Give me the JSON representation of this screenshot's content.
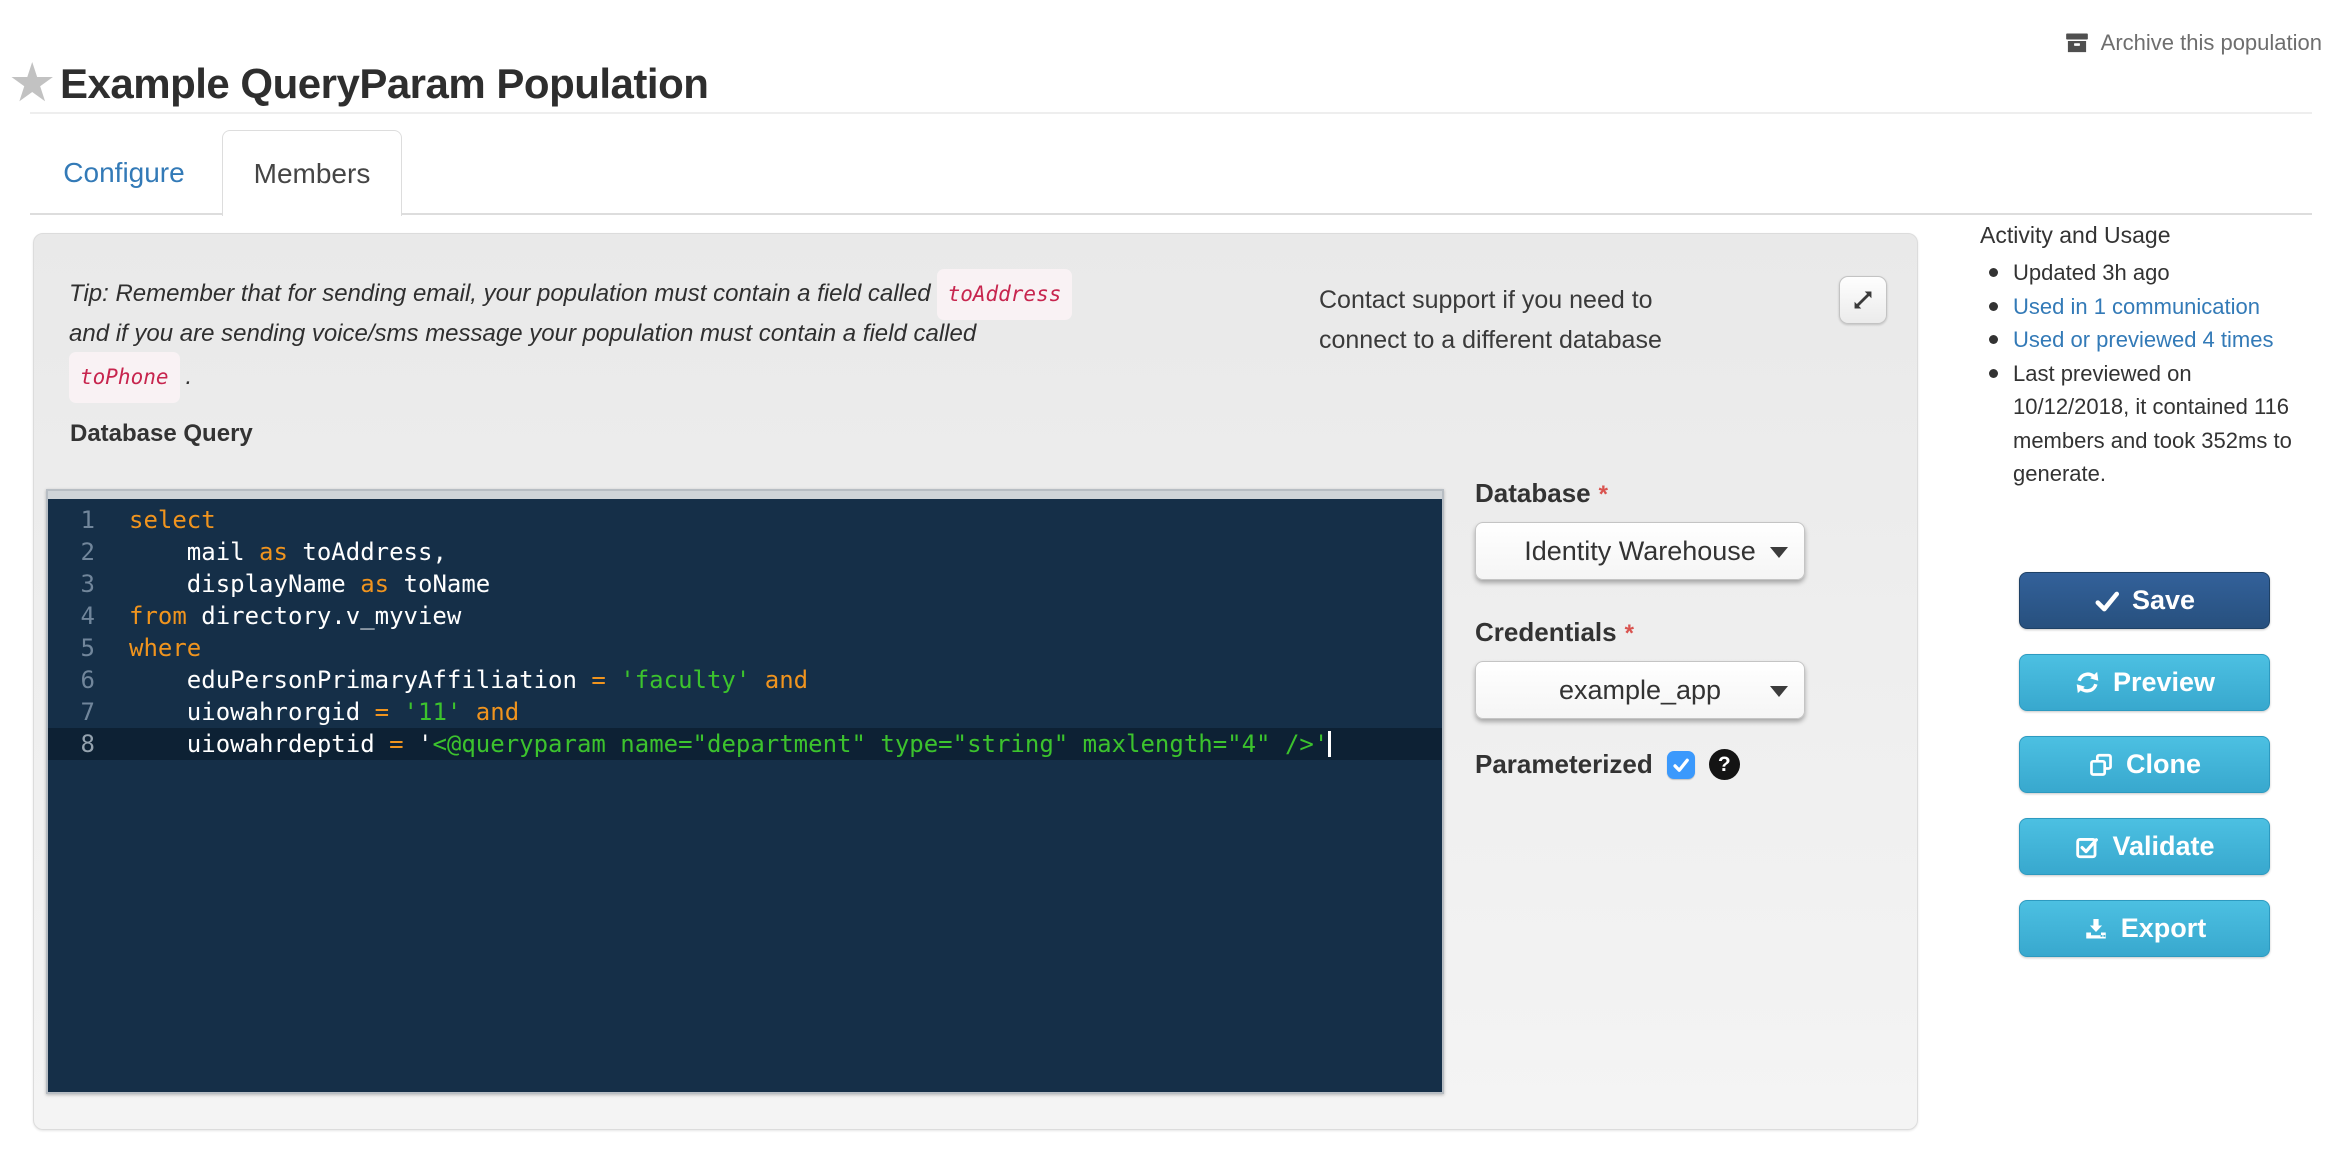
{
  "header": {
    "archive_label": "Archive this population",
    "title": "Example QueryParam Population"
  },
  "tabs": [
    {
      "label": "Configure",
      "active": false
    },
    {
      "label": "Members",
      "active": true
    }
  ],
  "panel": {
    "tip": {
      "line1_text": "Tip: Remember that for sending email, your population must contain a field called",
      "line1_code": "toAddress",
      "line2_text": "and if you are sending voice/sms message your population must contain a field called",
      "line3_code": "toPhone",
      "line3_suffix": "."
    },
    "contact_line1": "Contact support if you need to",
    "contact_line2": "connect to a different database",
    "query_label": "Database Query",
    "editor": {
      "lines": [
        {
          "num": "1",
          "tokens": [
            [
              "kw",
              "select"
            ]
          ]
        },
        {
          "num": "2",
          "tokens": [
            [
              "pl",
              "    mail "
            ],
            [
              "kw",
              "as"
            ],
            [
              "pl",
              " toAddress,"
            ]
          ]
        },
        {
          "num": "3",
          "tokens": [
            [
              "pl",
              "    displayName "
            ],
            [
              "kw",
              "as"
            ],
            [
              "pl",
              " toName"
            ]
          ]
        },
        {
          "num": "4",
          "tokens": [
            [
              "kw",
              "from"
            ],
            [
              "pl",
              " directory.v_myview"
            ]
          ]
        },
        {
          "num": "5",
          "tokens": [
            [
              "kw",
              "where"
            ]
          ]
        },
        {
          "num": "6",
          "tokens": [
            [
              "pl",
              "    eduPersonPrimaryAffiliation "
            ],
            [
              "kw",
              "="
            ],
            [
              "pl",
              " "
            ],
            [
              "str",
              "'faculty'"
            ],
            [
              "pl",
              " "
            ],
            [
              "kw",
              "and"
            ]
          ]
        },
        {
          "num": "7",
          "tokens": [
            [
              "pl",
              "    uiowahrorgid "
            ],
            [
              "kw",
              "="
            ],
            [
              "pl",
              " "
            ],
            [
              "str",
              "'11'"
            ],
            [
              "pl",
              " "
            ],
            [
              "kw",
              "and"
            ]
          ]
        },
        {
          "num": "8",
          "active": true,
          "cursor": true,
          "tokens": [
            [
              "pl",
              "    uiowahrdeptid "
            ],
            [
              "kw",
              "="
            ],
            [
              "pl",
              " '"
            ],
            [
              "str",
              "<@queryparam name=\"department\" type=\"string\" maxlength=\"4\" />'"
            ]
          ]
        }
      ]
    },
    "fields": {
      "database_label": "Database",
      "required_marker": "*",
      "database_value": "Identity Warehouse",
      "credentials_label": "Credentials",
      "credentials_value": "example_app",
      "parameterized_label": "Parameterized",
      "parameterized_checked": true
    }
  },
  "sidebar": {
    "heading": "Activity and Usage",
    "items": [
      {
        "text": "Updated 3h ago",
        "link": false
      },
      {
        "text": "Used in 1 communication",
        "link": true
      },
      {
        "text": "Used or previewed 4 times",
        "link": true
      },
      {
        "text": "Last previewed on 10/12/2018, it contained 116 members and took 352ms to generate.",
        "link": false
      }
    ],
    "buttons": [
      {
        "label": "Save",
        "icon": "check-icon",
        "style": "primary"
      },
      {
        "label": "Preview",
        "icon": "refresh-icon",
        "style": "info"
      },
      {
        "label": "Clone",
        "icon": "clone-icon",
        "style": "info"
      },
      {
        "label": "Validate",
        "icon": "validate-icon",
        "style": "info"
      },
      {
        "label": "Export",
        "icon": "export-icon",
        "style": "info"
      }
    ]
  },
  "colors": {
    "link": "#337ab7",
    "btn_primary_start": "#33619a",
    "btn_primary_end": "#27507e",
    "btn_primary_border": "#1e4166",
    "btn_info_start": "#4cc0e2",
    "btn_info_end": "#38a8ce",
    "btn_info_border": "#2d9ac0",
    "editor_bg": "#152f48",
    "editor_active_line": "#0d2134",
    "code_keyword": "#f0941e",
    "code_string": "#3cc32d",
    "code_plain": "#ffffff",
    "code_linenum": "#71869b",
    "chip_text": "#c7254e",
    "chip_bg": "#f9f2f4",
    "checkbox_blue": "#3b99fc",
    "required_red": "#d9534f"
  }
}
